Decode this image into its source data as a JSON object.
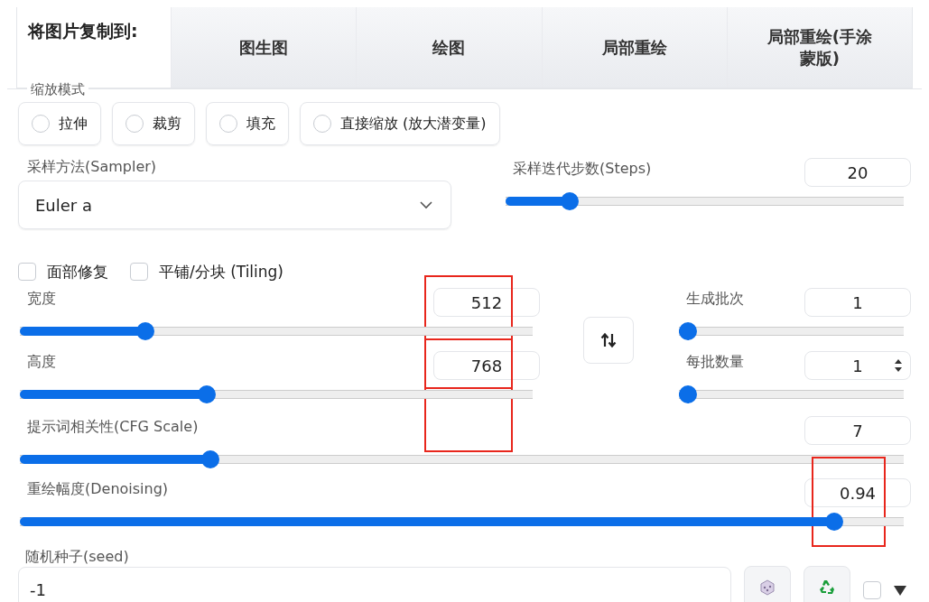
{
  "copy_to": {
    "label": "将图片复制到:",
    "buttons": [
      "图生图",
      "绘图",
      "局部重绘",
      "局部重绘(手涂蒙版)"
    ]
  },
  "resize_mode": {
    "legend": "缩放模式",
    "options": [
      {
        "label": "拉伸",
        "selected": false
      },
      {
        "label": "裁剪",
        "selected": false
      },
      {
        "label": "填充",
        "selected": false
      },
      {
        "label": "直接缩放 (放大潜变量)",
        "selected": false
      }
    ]
  },
  "sampler": {
    "label": "采样方法(Sampler)",
    "value": "Euler a"
  },
  "steps": {
    "label": "采样迭代步数(Steps)",
    "value": "20",
    "level": 0.145
  },
  "checkboxes": [
    {
      "label": "面部修复",
      "checked": false
    },
    {
      "label": "平铺/分块 (Tiling)",
      "checked": false
    }
  ],
  "size_sliders": [
    {
      "label": "宽度",
      "value": "512",
      "level": 0.235,
      "highlighted": true
    },
    {
      "label": "高度",
      "value": "768",
      "level": 0.36,
      "highlighted": true
    }
  ],
  "batch_sliders": [
    {
      "label": "生成批次",
      "value": "1",
      "level": 0,
      "kind": "plain"
    },
    {
      "label": "每批数量",
      "value": "1",
      "level": 0,
      "kind": "spinner"
    }
  ],
  "full_sliders": [
    {
      "label": "提示词相关性(CFG Scale)",
      "value": "7",
      "level": 0.21
    },
    {
      "label": "重绘幅度(Denoising)",
      "value": "0.94",
      "level": 0.93,
      "highlighted": true
    }
  ],
  "seed": {
    "label": "随机种子(seed)",
    "value": "-1",
    "extra_checked": false
  }
}
